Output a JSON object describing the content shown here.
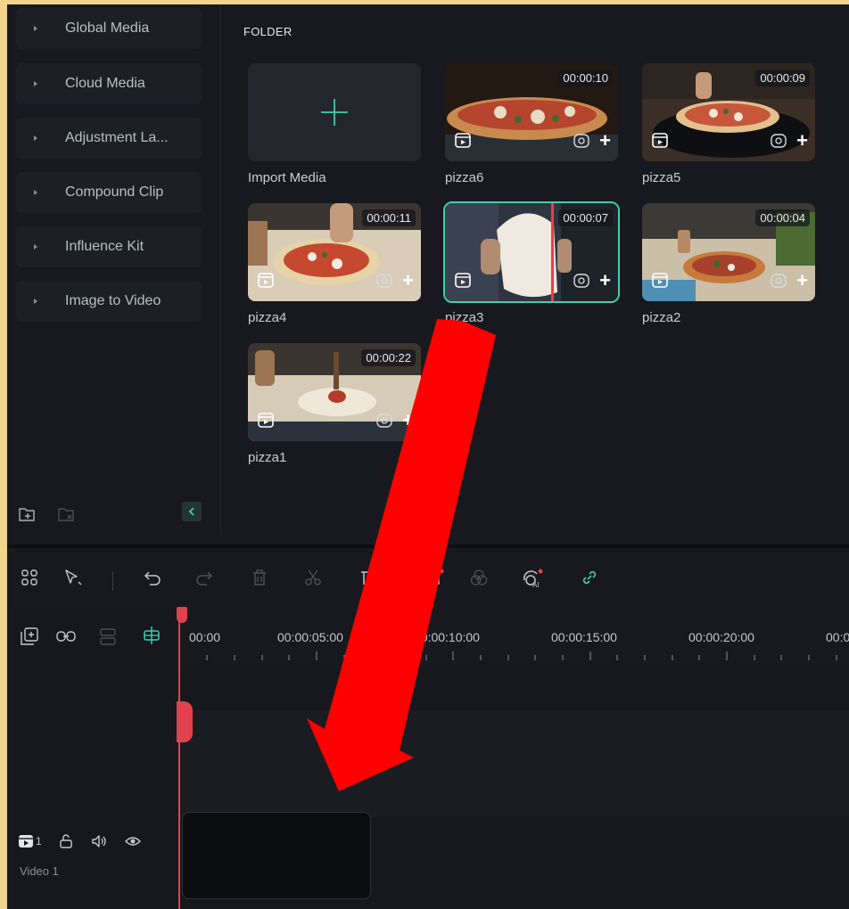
{
  "sidebar": {
    "items": [
      {
        "label": "Global Media"
      },
      {
        "label": "Cloud Media"
      },
      {
        "label": "Adjustment La..."
      },
      {
        "label": "Compound Clip"
      },
      {
        "label": "Influence Kit"
      },
      {
        "label": "Image to Video"
      }
    ]
  },
  "media": {
    "folder_title": "FOLDER",
    "import_label": "Import Media",
    "clips": [
      {
        "name": "pizza6",
        "duration": "00:00:10"
      },
      {
        "name": "pizza5",
        "duration": "00:00:09"
      },
      {
        "name": "pizza4",
        "duration": "00:00:11"
      },
      {
        "name": "pizza3",
        "duration": "00:00:07",
        "selected": true
      },
      {
        "name": "pizza2",
        "duration": "00:00:04"
      },
      {
        "name": "pizza1",
        "duration": "00:00:22"
      }
    ]
  },
  "timeline": {
    "ruler": [
      "00:00",
      "00:00:05:00",
      "00:00:10:00",
      "00:00:15:00",
      "00:00:20:00",
      "00:0"
    ],
    "track": {
      "number": "1",
      "name": "Video 1"
    }
  },
  "colors": {
    "accent": "#3fcfae",
    "playhead": "#e2424c",
    "annotation_arrow": "#ff0000"
  }
}
